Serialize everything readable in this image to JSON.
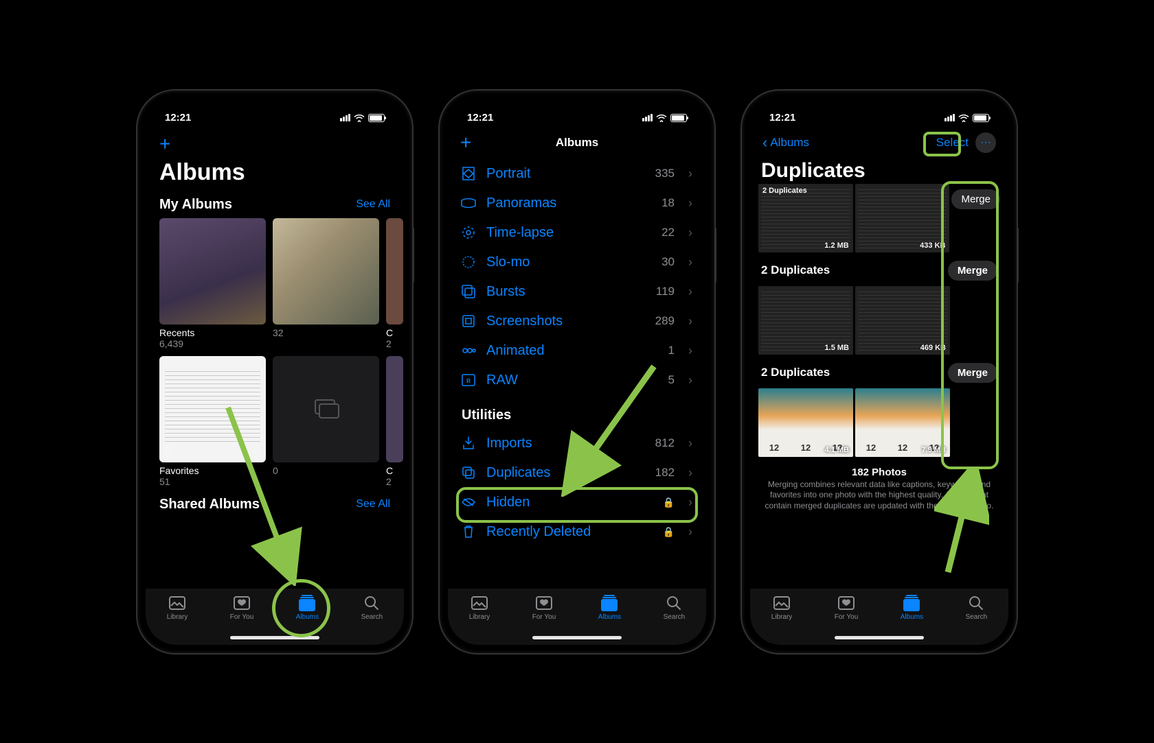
{
  "status": {
    "time": "12:21"
  },
  "screen1": {
    "title": "Albums",
    "sections": {
      "myAlbums": {
        "title": "My Albums",
        "seeAll": "See All"
      },
      "sharedAlbums": {
        "title": "Shared Albums",
        "seeAll": "See All"
      }
    },
    "albums": {
      "recents": {
        "name": "Recents",
        "count": "6,439"
      },
      "album2": {
        "name": "",
        "count": "32"
      },
      "album3_peek": {
        "name": "C",
        "count": "2"
      },
      "favorites": {
        "name": "Favorites",
        "count": "51"
      },
      "unnamed": {
        "name": "",
        "count": "0"
      },
      "peek2": {
        "name": "C",
        "count": "2"
      }
    },
    "tabs": {
      "library": "Library",
      "forYou": "For You",
      "albums": "Albums",
      "search": "Search"
    }
  },
  "screen2": {
    "navTitle": "Albums",
    "mediaTypes": {
      "portrait": {
        "label": "Portrait",
        "count": "335"
      },
      "panoramas": {
        "label": "Panoramas",
        "count": "18"
      },
      "timeLapse": {
        "label": "Time-lapse",
        "count": "22"
      },
      "sloMo": {
        "label": "Slo-mo",
        "count": "30"
      },
      "bursts": {
        "label": "Bursts",
        "count": "119"
      },
      "screenshots": {
        "label": "Screenshots",
        "count": "289"
      },
      "animated": {
        "label": "Animated",
        "count": "1"
      },
      "raw": {
        "label": "RAW",
        "count": "5"
      }
    },
    "utilities": {
      "header": "Utilities",
      "imports": {
        "label": "Imports",
        "count": "812"
      },
      "duplicates": {
        "label": "Duplicates",
        "count": "182"
      },
      "hidden": {
        "label": "Hidden"
      },
      "recentlyDeleted": {
        "label": "Recently Deleted"
      }
    }
  },
  "screen3": {
    "back": "Albums",
    "select": "Select",
    "title": "Duplicates",
    "groups": {
      "g1": {
        "header": "2 Duplicates",
        "merge": "Merge",
        "sizes": [
          "1.2 MB",
          "433 KB"
        ]
      },
      "g2": {
        "header": "2 Duplicates",
        "merge": "Merge",
        "sizes": [
          "1.5 MB",
          "469 KB"
        ]
      },
      "g3": {
        "header": "2 Duplicates",
        "merge": "Merge",
        "sizes": [
          "4.1 MB",
          "7.9 MB"
        ]
      }
    },
    "footer": {
      "count": "182 Photos",
      "desc": "Merging combines relevant data like captions, keywords, and favorites into one photo with the highest quality. Albums that contain merged duplicates are updated with the merged photo."
    }
  }
}
